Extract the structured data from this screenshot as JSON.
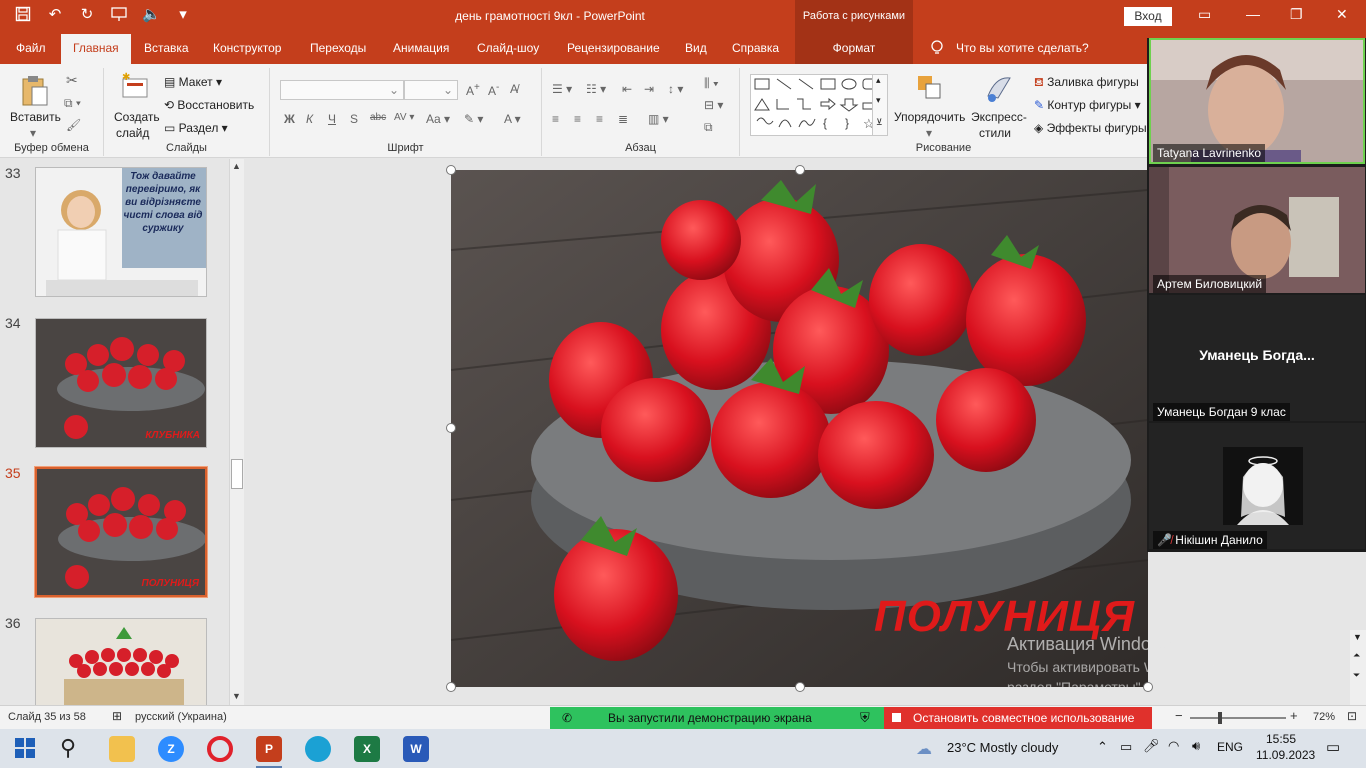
{
  "titlebar": {
    "doc_title": "день грамотності 9кл  -  PowerPoint",
    "context_tab_header": "Работа с рисунками",
    "login_label": "Вход"
  },
  "tabs": [
    {
      "label": "Файл"
    },
    {
      "label": "Главная"
    },
    {
      "label": "Вставка"
    },
    {
      "label": "Конструктор"
    },
    {
      "label": "Переходы"
    },
    {
      "label": "Анимация"
    },
    {
      "label": "Слайд-шоу"
    },
    {
      "label": "Рецензирование"
    },
    {
      "label": "Вид"
    },
    {
      "label": "Справка"
    },
    {
      "label": "Формат"
    }
  ],
  "tell_me": "Что вы хотите сделать?",
  "ribbon": {
    "clipboard": {
      "paste": "Вставить",
      "group": "Буфер обмена"
    },
    "slides": {
      "new_slide_1": "Создать",
      "new_slide_2": "слайд",
      "layout": "Макет",
      "reset": "Восстановить",
      "section": "Раздел",
      "group": "Слайды"
    },
    "font": {
      "group": "Шрифт"
    },
    "paragraph": {
      "group": "Абзац"
    },
    "drawing": {
      "arrange_1": "Упорядочить",
      "quick_styles_1": "Экспресс-",
      "quick_styles_2": "стили",
      "fill": "Заливка фигуры",
      "outline": "Контур фигуры",
      "effects": "Эффекты фигуры",
      "group": "Рисование"
    }
  },
  "thumbnails": [
    {
      "num": "33",
      "text": "Тож давайте перевіримо, як ви відрізняєте чисті слова від суржику"
    },
    {
      "num": "34",
      "text": "КЛУБНИКА"
    },
    {
      "num": "35",
      "text": "ПОЛУНИЦЯ"
    },
    {
      "num": "36",
      "text": ""
    }
  ],
  "slide": {
    "word": "ПОЛУНИЦЯ"
  },
  "watermark": {
    "line1": "Активация Windows",
    "line2": "Чтобы активировать Windows, перейдите в раздел \"Параметры\"."
  },
  "zoom": {
    "participants": [
      {
        "name": "Tatyana Lavrinenko"
      },
      {
        "name": "Артем Биловицкий"
      },
      {
        "name": "Уманець Богдан 9 клас",
        "big_name": "Уманець  Богда..."
      },
      {
        "name": "Нікішин Данило"
      }
    ]
  },
  "status": {
    "slide_info": "Слайд 35 из 58",
    "language": "русский (Украина)",
    "share_notice": "Вы запустили демонстрацию экрана",
    "stop_share": "Остановить совместное использование",
    "zoom_level": "72%"
  },
  "taskbar": {
    "weather": "23°C  Mostly cloudy",
    "lang": "ENG",
    "time": "15:55",
    "date": "11.09.2023"
  },
  "colors": {
    "accent": "#c43e1c",
    "share_green": "#2ec25e",
    "share_red": "#e0312c"
  }
}
